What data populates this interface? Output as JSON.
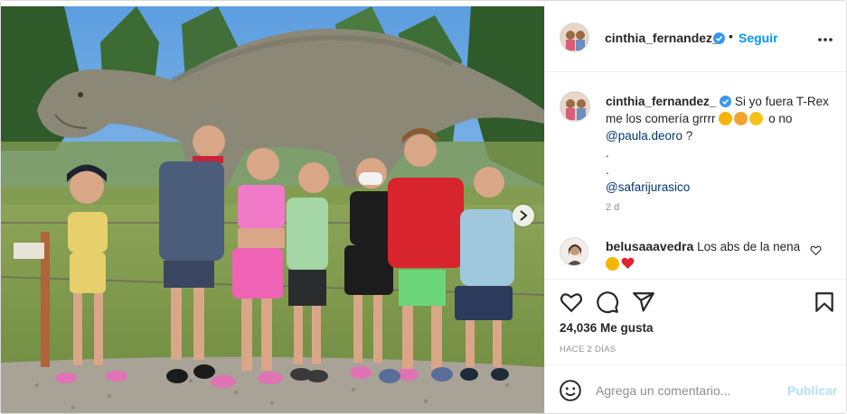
{
  "post": {
    "username": "cinthia_fernandez_",
    "follow_label": "Seguir",
    "separator": "•",
    "caption": {
      "username": "cinthia_fernandez_",
      "text_line1": "Si yo fuera T-Rex",
      "text_line2a": "me los comería grrrr",
      "text_line2b": "o no",
      "mention": "@paula.deoro",
      "text_q": "?",
      "dot1": ".",
      "dot2": ".",
      "mention2": "@safarijurasico",
      "time": "2 d"
    },
    "comment": {
      "username": "belusaaavedra",
      "text": "Los abs de la nena"
    },
    "likes": "24,036 Me gusta",
    "time_ago": "HACE 2 DÍAS",
    "comment_placeholder": "Agrega un comentario...",
    "publish_label": "Publicar"
  },
  "icons": {
    "verified": "verified-badge-icon",
    "more": "more-options-icon",
    "like": "heart-icon",
    "comment": "comment-icon",
    "share": "share-icon",
    "save": "bookmark-icon",
    "emoji": "emoji-icon",
    "next": "chevron-right-icon"
  },
  "colors": {
    "accent": "#0095f6",
    "publish_disabled": "#b2dffc",
    "mention": "#00376b",
    "secondary_text": "#8e8e8e",
    "heart_red": "#ed4956"
  }
}
